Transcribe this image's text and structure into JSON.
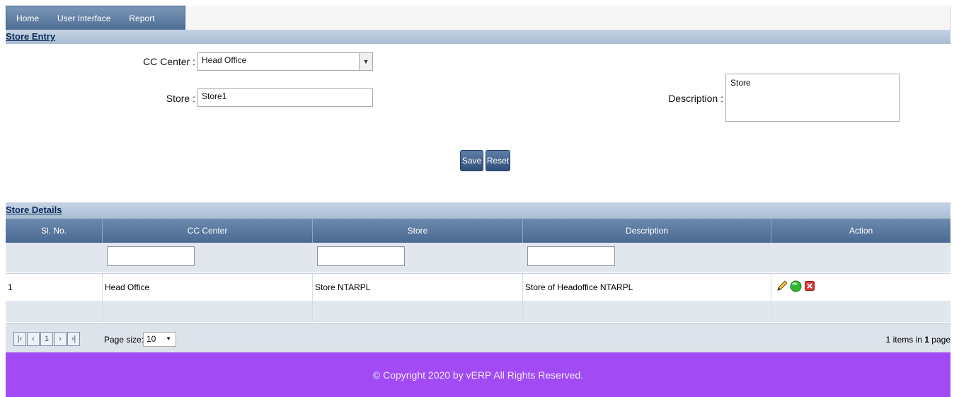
{
  "nav": {
    "items": [
      "Home",
      "User Interface",
      "Report"
    ]
  },
  "store_entry": {
    "title": "Store Entry",
    "cc_center_label": "CC Center :",
    "cc_center_value": "Head Office",
    "store_label": "Store :",
    "store_value": "Store1",
    "description_label": "Description :",
    "description_value": "Store",
    "save_label": "Save",
    "reset_label": "Reset"
  },
  "store_details": {
    "title": "Store Details",
    "columns": [
      "Sl. No.",
      "CC Center",
      "Store",
      "Description",
      "Action"
    ],
    "rows": [
      {
        "sl": "1",
        "cc_center": "Head Office",
        "store": "Store NTARPL",
        "description": "Store of Headoffice NTARPL"
      }
    ]
  },
  "pager": {
    "current_page": "1",
    "page_size_label": "Page size:",
    "page_size_value": "10",
    "items_count": "1",
    "items_text": "items in",
    "pages_count": "1",
    "pages_text": "page"
  },
  "icons": {
    "edit": "pencil-icon",
    "status": "green-dot-icon",
    "delete": "delete-icon"
  },
  "colors": {
    "footer": "#a24bf5",
    "header_bar": "#4b6a92"
  },
  "footer": {
    "text": "© Copyright 2020 by vERP All Rights Reserved."
  }
}
